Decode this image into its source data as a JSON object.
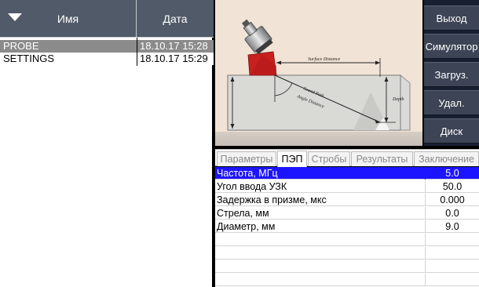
{
  "file_list": {
    "header": {
      "name": "Имя",
      "date": "Дата"
    },
    "rows": [
      {
        "name": "PROBE",
        "date": "18.10.17 15:28",
        "selected": true
      },
      {
        "name": "SETTINGS",
        "date": "18.10.17 15:29",
        "selected": false
      }
    ]
  },
  "diagram": {
    "surface_distance": "Surface Distance",
    "sound_path": "Sound Path",
    "angle_distance": "Angle Distance",
    "depth": "Depth"
  },
  "buttons": [
    "Выход",
    "Симулятор",
    "Загруз.",
    "Удал.",
    "Диск"
  ],
  "tabs": [
    "Параметры",
    "ПЭП",
    "Стробы",
    "Результаты",
    "Заключение"
  ],
  "active_tab": "ПЭП",
  "params": [
    {
      "label": "Частота, МГц",
      "value": "5.0",
      "selected": true
    },
    {
      "label": "Угол ввода УЗК",
      "value": "50.0",
      "selected": false
    },
    {
      "label": "Задержка в призме, мкс",
      "value": "0.000",
      "selected": false
    },
    {
      "label": "Стрела, мм",
      "value": "0.0",
      "selected": false
    },
    {
      "label": "Диаметр, мм",
      "value": "9.0",
      "selected": false
    },
    {
      "label": "",
      "value": "",
      "selected": false
    },
    {
      "label": "",
      "value": "",
      "selected": false
    },
    {
      "label": "",
      "value": "",
      "selected": false
    },
    {
      "label": "",
      "value": "",
      "selected": false
    }
  ],
  "colors": {
    "selection": "#1d14ff",
    "header": "#515a68",
    "button": "#3c4455",
    "wedge": "#c8201e"
  }
}
